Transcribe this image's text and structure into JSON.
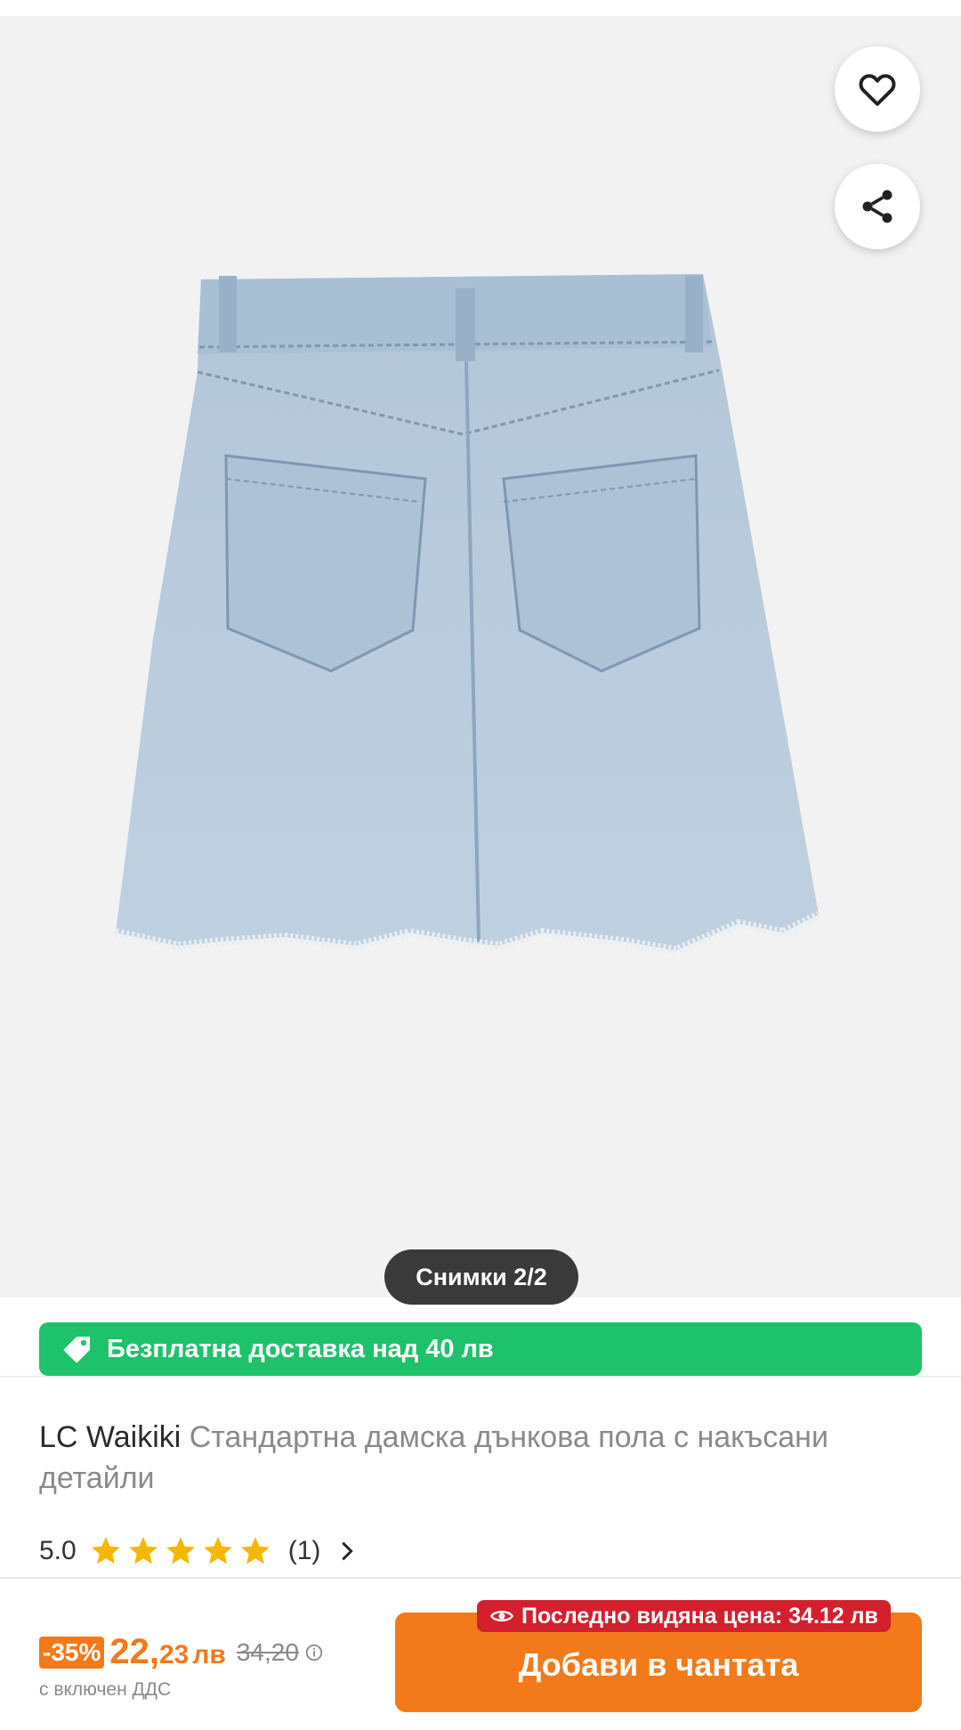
{
  "gallery": {
    "photo_counter": "Снимки 2/2"
  },
  "icons": {
    "favorite": "heart-outline-icon",
    "share": "share-icon",
    "tag": "tag-icon",
    "eye": "eye-icon",
    "chevron": "chevron-right-icon",
    "info": "info-icon"
  },
  "promo": {
    "free_delivery": "Безплатна доставка над 40 лв"
  },
  "product": {
    "brand": "LC Waikiki",
    "title": "Стандартна дамска дънкова пола с накъсани детайли",
    "rating_value": "5.0",
    "rating_stars": 5,
    "rating_count": "(1)"
  },
  "purchase": {
    "discount": "-35%",
    "price_int": "22,",
    "price_dec": "23",
    "currency": "лв",
    "old_price": "34,20",
    "vat_note": "с включен ДДС",
    "last_seen_price": "Последно видяна цена: 34.12 лв",
    "add_to_cart": "Добави в чантата"
  },
  "colors": {
    "accent_orange": "#f27a1a",
    "promo_green": "#1ec26a",
    "alert_red": "#d4202c",
    "star_yellow": "#f5b800"
  }
}
